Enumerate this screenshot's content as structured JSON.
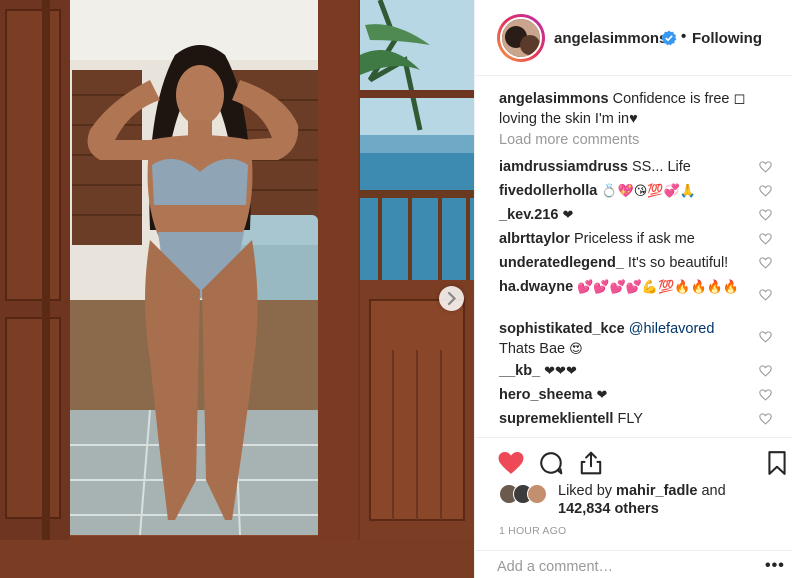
{
  "post": {
    "photo_alt": "",
    "has_next_slide": true
  },
  "header": {
    "username": "angelasimmons",
    "verified": true,
    "separator": "•",
    "follow_status": "Following"
  },
  "caption": {
    "username": "angelasimmons",
    "text": " Confidence is free ◻ loving the skin I'm in♥"
  },
  "load_more": "Load more comments",
  "comments": [
    {
      "user": "iamdrussiamdruss",
      "text": " SS... Life",
      "emoji": ""
    },
    {
      "user": "fivedollerholla",
      "text": " ",
      "emoji": "💍💖😘💯💞🙏"
    },
    {
      "user": "_kev.216",
      "text": " ",
      "emoji": "❤"
    },
    {
      "user": "albrttaylor",
      "text": " Priceless if ask me",
      "emoji": ""
    },
    {
      "user": "underatedlegend_",
      "text": " It's so beautiful!",
      "emoji": ""
    },
    {
      "user": "ha.dwayne",
      "text": " ",
      "emoji": "💕💕💕💕💪💯🔥🔥🔥🔥"
    },
    {
      "user": "sophistikated_kce",
      "mention": " @hilefavored",
      "text": " Thats Bae ",
      "emoji": "😍"
    },
    {
      "user": "__kb_",
      "text": " ",
      "emoji": "❤❤❤"
    },
    {
      "user": "hero_sheema",
      "text": " ",
      "emoji": "❤"
    },
    {
      "user": "supremeklientell",
      "text": " FLY",
      "emoji": ""
    }
  ],
  "actions": {
    "like_icon": "heart-filled-icon",
    "comment_icon": "comment-icon",
    "share_icon": "share-icon",
    "save_icon": "bookmark-icon",
    "like_color": "#ed4956"
  },
  "likes": {
    "prefix": "Liked by ",
    "liked_by_user": "mahir_fadle",
    "connector": " and ",
    "count": "142,834 others"
  },
  "timestamp": "1 HOUR AGO",
  "add_comment": {
    "placeholder": "Add a comment…",
    "more": "•••"
  }
}
